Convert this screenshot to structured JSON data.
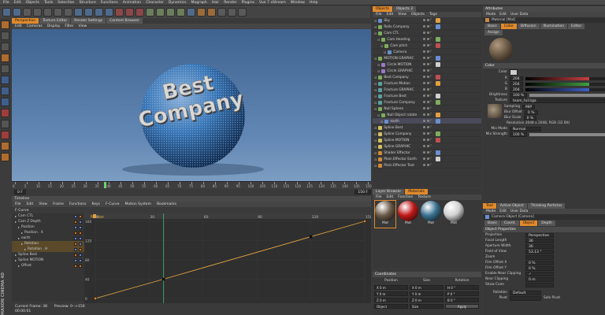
{
  "menubar": [
    "File",
    "Edit",
    "Objects",
    "Tools",
    "Selection",
    "Structure",
    "Functions",
    "Animation",
    "Character",
    "Dynamics",
    "Mograph",
    "Hair",
    "Render",
    "Plugins",
    "Vue 7 xStream",
    "Window",
    "Help"
  ],
  "viewport": {
    "tabs": [
      {
        "label": "Perspective",
        "active": true
      },
      {
        "label": "Texture Editor",
        "active": false
      },
      {
        "label": "Render Settings",
        "active": false
      },
      {
        "label": "Content Browser",
        "active": false
      }
    ],
    "menu": [
      "Edit",
      "Cameras",
      "Display",
      "Filter",
      "View"
    ],
    "logo_line1": "Best",
    "logo_line2": "Company",
    "ruler_ticks": [
      "0",
      "5",
      "10",
      "15",
      "20",
      "25",
      "30",
      "35",
      "40",
      "45",
      "50",
      "55",
      "60",
      "65",
      "70",
      "75",
      "80",
      "85",
      "90",
      "95",
      "100",
      "105",
      "110",
      "115",
      "120",
      "125",
      "130",
      "135",
      "140",
      "145",
      "150"
    ],
    "frame_field": "0 F",
    "end_field": "150 F"
  },
  "timeline": {
    "title": "Timeline",
    "menu": [
      "File",
      "Edit",
      "View",
      "Frame",
      "Functions",
      "Keys",
      "F-Curve",
      "Motion System",
      "Bookmarks"
    ],
    "fcurve_label": "F-Curve",
    "marker_label": "Marker",
    "tracks": [
      "Cam CTL",
      "Cam Z Depth",
      "Position",
      "Position . X",
      "earth",
      "Rotation",
      "Rotation . H",
      "Spline Best",
      "Spline MOTION",
      "Offset"
    ],
    "graph_x_ticks": [
      "0",
      "30",
      "60",
      "90",
      "120",
      "150"
    ],
    "graph_y_ticks": [
      "160",
      "120",
      "80",
      "40",
      "0"
    ],
    "status_frame": "Current Frame: 38",
    "status_preview": "Preview: 0-->150",
    "status_time": "00:00:01"
  },
  "objects": {
    "tabs": [
      {
        "label": "Objects",
        "active": true
      },
      {
        "label": "Objects 2",
        "active": false
      }
    ],
    "menu": [
      "File",
      "Edit",
      "View",
      "Objects",
      "Tags"
    ],
    "items": [
      {
        "name": "Sky",
        "indent": 0,
        "icon": "b"
      },
      {
        "name": "Rollo Company",
        "indent": 0,
        "icon": "g"
      },
      {
        "name": "Cam CTL",
        "indent": 0,
        "icon": "g"
      },
      {
        "name": "Cam Heading",
        "indent": 1,
        "icon": "g"
      },
      {
        "name": "Cam pitch",
        "indent": 2,
        "icon": "g"
      },
      {
        "name": "Camera",
        "indent": 3,
        "icon": "b"
      },
      {
        "name": "MOTION GRAPHIC",
        "indent": 0,
        "icon": "g"
      },
      {
        "name": "Circle MOTION",
        "indent": 1,
        "icon": "p"
      },
      {
        "name": "Circle GRAPHIC",
        "indent": 1,
        "icon": "p"
      },
      {
        "name": "Best Company",
        "indent": 0,
        "icon": "g"
      },
      {
        "name": "Fracture Motion",
        "indent": 0,
        "icon": "t"
      },
      {
        "name": "Fracture GRAPHIC",
        "indent": 0,
        "icon": "t"
      },
      {
        "name": "Fracture Best",
        "indent": 0,
        "icon": "t"
      },
      {
        "name": "Fracture Company",
        "indent": 0,
        "icon": "t"
      },
      {
        "name": "Null Sphere",
        "indent": 0,
        "icon": "g"
      },
      {
        "name": "Null Object rotate",
        "indent": 1,
        "icon": "g"
      },
      {
        "name": "earth",
        "indent": 2,
        "icon": "b"
      },
      {
        "name": "Spline Best",
        "indent": 0,
        "icon": "y"
      },
      {
        "name": "Spline Company",
        "indent": 0,
        "icon": "y"
      },
      {
        "name": "Spline MOTION",
        "indent": 0,
        "icon": "y"
      },
      {
        "name": "Spline GRAPHIC",
        "indent": 0,
        "icon": "y"
      },
      {
        "name": "Shader Effector",
        "indent": 0,
        "icon": "o"
      },
      {
        "name": "Plain Effector Earth",
        "indent": 0,
        "icon": "o"
      },
      {
        "name": "Plain Effector Text",
        "indent": 0,
        "icon": "o"
      }
    ]
  },
  "materials": {
    "tabs": [
      {
        "label": "Layer Browser",
        "active": false
      },
      {
        "label": "Materials",
        "active": true
      }
    ],
    "menu": [
      "File",
      "Edit",
      "Function",
      "Texture"
    ],
    "items": [
      {
        "label": "Mat",
        "color": "#6a5a48"
      },
      {
        "label": "Mat",
        "color": "#c01818"
      },
      {
        "label": "Mat",
        "color": "#3a7090"
      },
      {
        "label": "Mat",
        "color": "#d0d0d0"
      }
    ]
  },
  "coords": {
    "title": "Coordinates",
    "headers": [
      "Position",
      "Size",
      "Rotation"
    ],
    "rows": [
      [
        "X 0 m",
        "X 0 m",
        "H 0 °"
      ],
      [
        "Y 0 m",
        "Y 0 m",
        "P 0 °"
      ],
      [
        "Z 0 m",
        "Z 0 m",
        "B 0 °"
      ]
    ],
    "mode": "Object",
    "size_mode": "Size",
    "apply": "Apply"
  },
  "attributes": {
    "title": "Attributes",
    "menu": [
      "Mode",
      "Edit",
      "User Data"
    ],
    "material_name": "Material [Mat]",
    "tabs": [
      "Basic",
      "Color",
      "Diffusion",
      "Illumination",
      "Editor",
      "Assign"
    ],
    "section_color": "Color",
    "color_label": "Color",
    "rgb": [
      {
        "ch": "R",
        "val": "204",
        "color": "#c84040"
      },
      {
        "ch": "G",
        "val": "204",
        "color": "#40a040"
      },
      {
        "ch": "B",
        "val": "204",
        "color": "#4060c8"
      }
    ],
    "brightness_label": "Brightness",
    "brightness_val": "100 %",
    "texture_label": "Texture",
    "texture_file": "team_full.tga",
    "sampling_label": "Sampling",
    "sampling_val": "MIP",
    "blur_offset_label": "Blur Offset",
    "blur_offset_val": "0 %",
    "blur_scale_label": "Blur Scale",
    "blur_scale_val": "0 %",
    "resolution": "Resolution 2048 x 2048, RGB (32 Bit)",
    "mix_mode_label": "Mix Mode",
    "mix_mode_val": "Normal",
    "mix_strength_label": "Mix Strength",
    "mix_strength_val": "100 %"
  },
  "attributes2": {
    "tabs": [
      {
        "label": "Tool",
        "active": true
      },
      {
        "label": "Active Object",
        "active": false
      },
      {
        "label": "Thinking Particles",
        "active": false
      }
    ],
    "menu": [
      "Mode",
      "Edit",
      "User Data"
    ],
    "object_name": "Camera Object [Camera]",
    "subtabs": [
      "Basic",
      "Coord.",
      "Object",
      "Depth"
    ],
    "section": "Object Properties",
    "rows": [
      {
        "label": "Projection",
        "value": "Perspective"
      },
      {
        "label": "Focal Length",
        "value": "36"
      },
      {
        "label": "Aperture Width",
        "value": "36"
      },
      {
        "label": "Field of View",
        "value": "53.13 °"
      },
      {
        "label": "Zoom",
        "value": ""
      },
      {
        "label": "Film Offset X",
        "value": "0 %"
      },
      {
        "label": "Film Offset Y",
        "value": "0 %"
      },
      {
        "label": "Enable Near Clipping",
        "value": "✓"
      },
      {
        "label": "Near Clipping",
        "value": "0 m"
      },
      {
        "label": "Show Cone",
        "value": ""
      }
    ],
    "rotation_label": "Rotation",
    "rotation_val": "Default",
    "pivot_label": "Pivot",
    "solo_label": "Solo Pivot"
  },
  "chart_data": {
    "type": "line",
    "x": [
      0,
      38,
      120,
      150
    ],
    "y": [
      0,
      40,
      128,
      160
    ],
    "xlim": [
      0,
      150
    ],
    "ylim": [
      0,
      160
    ]
  },
  "colors": {
    "accent": "#e08a2c",
    "sky": "#4f6f9a",
    "curve": "#e0a040",
    "key": "#1a1a1a"
  },
  "brand": "MAXON CINEMA 4D"
}
